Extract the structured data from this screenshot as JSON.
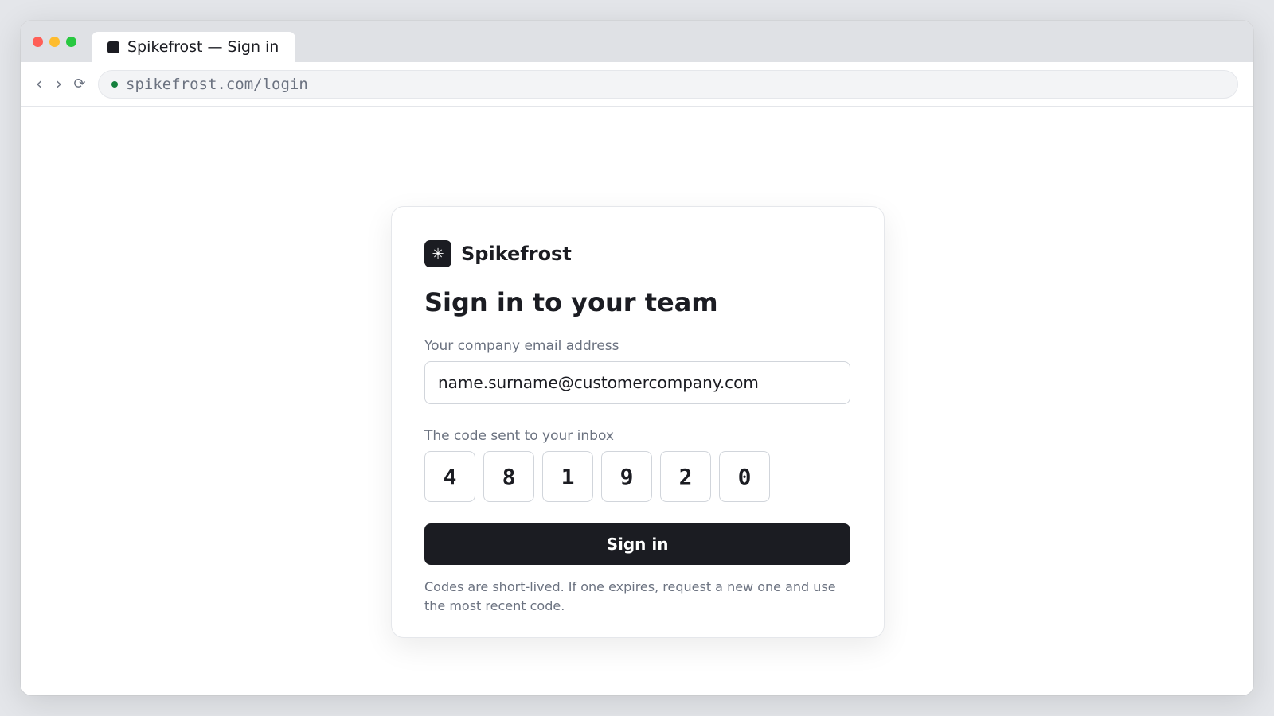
{
  "browser": {
    "tab": {
      "title": "Spikefrost — Sign in"
    },
    "nav": {
      "back_icon": "‹",
      "forward_icon": "›",
      "reload_icon": "⟳"
    },
    "address_bar": {
      "url": "spikefrost.com/login",
      "secure_color": "#15803d"
    }
  },
  "card": {
    "brand": {
      "logo_glyph": "✳",
      "name": "Spikefrost"
    },
    "heading": "Sign in to your team",
    "email": {
      "label": "Your company email address",
      "value": "name.surname@customercompany.com"
    },
    "code": {
      "label": "The code sent to your inbox",
      "digits": [
        "4",
        "8",
        "1",
        "9",
        "2",
        "0"
      ]
    },
    "submit_label": "Sign in",
    "note": "Codes are short-lived. If one expires, request a new one and use the most recent code."
  },
  "colors": {
    "primary": "#1b1c22",
    "muted_text": "#6b7280",
    "border": "#d1d5db"
  }
}
